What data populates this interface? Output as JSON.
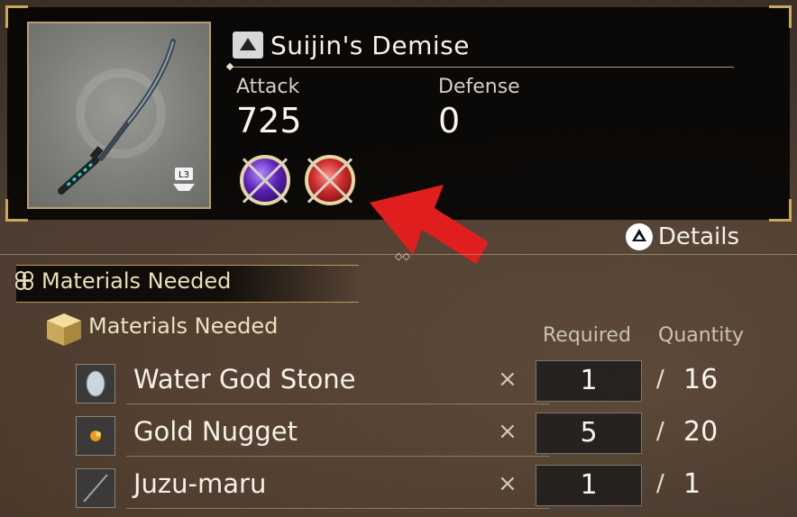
{
  "item": {
    "name": "Suijin's Demise",
    "level_badge": "L3",
    "stats": [
      {
        "label": "Attack",
        "value": "725"
      },
      {
        "label": "Defense",
        "value": "0"
      }
    ],
    "orbs": [
      "purple-soul-core-orb",
      "red-soul-core-orb"
    ]
  },
  "details_label": "Details",
  "materials": {
    "section_title": "Materials Needed",
    "sub_title": "Materials Needed",
    "col_required": "Required",
    "col_quantity": "Quantity",
    "times_symbol": "×",
    "slash_symbol": "/",
    "rows": [
      {
        "name": "Water God Stone",
        "required": "1",
        "quantity": "16",
        "icon": "water-god-stone-icon"
      },
      {
        "name": "Gold Nugget",
        "required": "5",
        "quantity": "20",
        "icon": "gold-nugget-icon"
      },
      {
        "name": "Juzu-maru",
        "required": "1",
        "quantity": "1",
        "icon": "juzu-maru-icon"
      }
    ]
  },
  "colors": {
    "accent_gold": "#c9a85a",
    "arrow_red": "#e01e1e",
    "panel": "#060504"
  }
}
